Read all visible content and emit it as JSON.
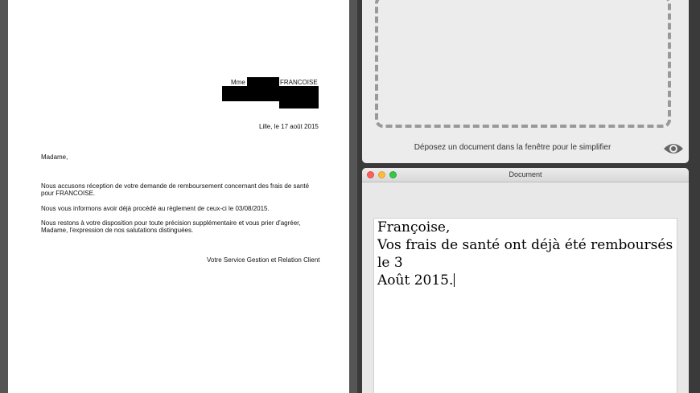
{
  "letter": {
    "recipient_prefix": "Mme",
    "recipient_name": "FRANCOISE",
    "date_line": "Lille, le 17 août 2015",
    "salutation": "Madame,",
    "para1_line1": "Nous accusons réception de votre demande de remboursement concernant des frais de santé",
    "para1_line2": "pour FRANCOISE.",
    "para2": "Nous vous informons avoir déjà procédé au règlement de ceux-ci le 03/08/2015.",
    "para3_line1": "Nous restons à votre disposition pour toute précision supplémentaire et vous prier d'agréer,",
    "para3_line2": "Madame, l'expression de nos salutations distinguées.",
    "signature": "Votre Service Gestion et Relation Client"
  },
  "dropzone": {
    "label": "Déposez un document dans la fenêtre pour le simplifier",
    "icon": "eye-icon"
  },
  "document_window": {
    "title": "Document",
    "traffic_lights": {
      "close": "#fc605c",
      "minimize": "#fdbc40",
      "zoom": "#34c84a"
    },
    "line1": "Françoise,",
    "line2": "Vos frais de santé ont déjà été remboursés le 3",
    "line3": "Août 2015."
  }
}
